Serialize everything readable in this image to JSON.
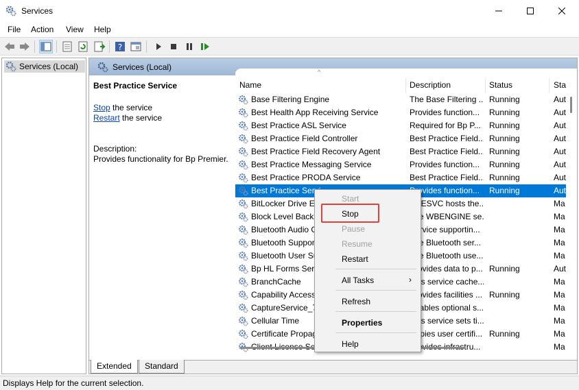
{
  "window": {
    "title": "Services"
  },
  "menu": [
    "File",
    "Action",
    "View",
    "Help"
  ],
  "tree": {
    "root": "Services (Local)"
  },
  "content": {
    "header": "Services (Local)",
    "detail": {
      "name": "Best Practice Service",
      "stop_link": "Stop",
      "stop_rest": "the service",
      "restart_link": "Restart",
      "restart_rest": "the service",
      "description_label": "Description:",
      "description": "Provides functionality for Bp Premier."
    }
  },
  "columns": [
    "Name",
    "Description",
    "Status",
    "Sta"
  ],
  "services": [
    {
      "name": "Base Filtering Engine",
      "description": "The Base Filtering ...",
      "status": "Running",
      "startup": "Aut"
    },
    {
      "name": "Best Health App Receiving Service",
      "description": "Provides function...",
      "status": "Running",
      "startup": "Aut"
    },
    {
      "name": "Best Practice ASL Service",
      "description": "Required for Bp P...",
      "status": "Running",
      "startup": "Aut"
    },
    {
      "name": "Best Practice Field Controller",
      "description": "Best Practice Field...",
      "status": "Running",
      "startup": "Aut"
    },
    {
      "name": "Best Practice Field Recovery Agent",
      "description": "Best Practice Field...",
      "status": "Running",
      "startup": "Aut"
    },
    {
      "name": "Best Practice Messaging Service",
      "description": "Provides function...",
      "status": "Running",
      "startup": "Aut"
    },
    {
      "name": "Best Practice PRODA Service",
      "description": "Best Practice Field...",
      "status": "Running",
      "startup": "Aut"
    },
    {
      "name": "Best Practice Servi",
      "description": "Provides function...",
      "status": "Running",
      "startup": "Aut"
    },
    {
      "name": "BitLocker Drive En",
      "description": "BDESVC hosts the...",
      "status": "",
      "startup": "Ma"
    },
    {
      "name": "Block Level Backu",
      "description": "The WBENGINE se...",
      "status": "",
      "startup": "Ma"
    },
    {
      "name": "Bluetooth Audio G",
      "description": "Service supportin...",
      "status": "",
      "startup": "Ma"
    },
    {
      "name": "Bluetooth Suppor",
      "description": "The Bluetooth ser...",
      "status": "",
      "startup": "Ma"
    },
    {
      "name": "Bluetooth User Su",
      "description": "The Bluetooth use...",
      "status": "",
      "startup": "Ma"
    },
    {
      "name": "Bp HL Forms Serv",
      "description": "Provides data to p...",
      "status": "Running",
      "startup": "Aut"
    },
    {
      "name": "BranchCache",
      "description": "This service cache...",
      "status": "",
      "startup": "Ma"
    },
    {
      "name": "Capability Access",
      "description": "Provides facilities ...",
      "status": "Running",
      "startup": "Ma"
    },
    {
      "name": "CaptureService_71",
      "description": "Enables optional s...",
      "status": "",
      "startup": "Ma"
    },
    {
      "name": "Cellular Time",
      "description": "This service sets ti...",
      "status": "",
      "startup": "Ma"
    },
    {
      "name": "Certificate Propag",
      "description": "Copies user certifi...",
      "status": "Running",
      "startup": "Ma"
    },
    {
      "name": "Client License Serv",
      "description": "Provides infrastru...",
      "status": "",
      "startup": "Ma"
    }
  ],
  "selected_index": 7,
  "context_menu": {
    "start": "Start",
    "stop": "Stop",
    "pause": "Pause",
    "resume": "Resume",
    "restart": "Restart",
    "all_tasks": "All Tasks",
    "refresh": "Refresh",
    "properties": "Properties",
    "help": "Help"
  },
  "tabs": [
    "Extended",
    "Standard"
  ],
  "status_bar": "Displays Help for the current selection."
}
